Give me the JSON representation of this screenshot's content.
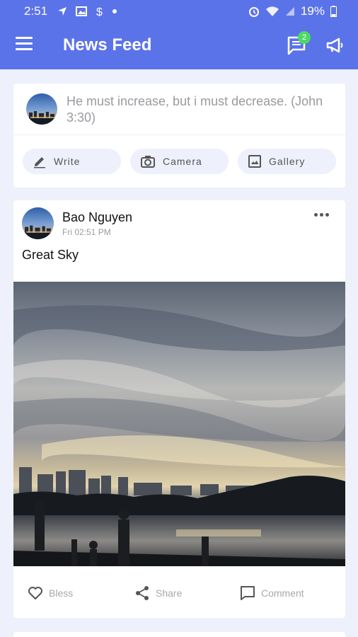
{
  "status_bar": {
    "time": "2:51",
    "battery": "19%"
  },
  "app_bar": {
    "title": "News Feed",
    "chat_badge": "2",
    "accent_color": "#5b73e8"
  },
  "composer": {
    "placeholder": "He must increase, but i must decrease. (John 3:30)",
    "actions": [
      {
        "label": "Write",
        "icon": "pencil-icon"
      },
      {
        "label": "Camera",
        "icon": "camera-icon"
      },
      {
        "label": "Gallery",
        "icon": "image-icon"
      }
    ]
  },
  "post": {
    "author": "Bao Nguyen",
    "timestamp": "Fri 02:51 PM",
    "caption": "Great Sky",
    "reactions": [
      {
        "label": "Bless",
        "icon": "heart-icon"
      },
      {
        "label": "Share",
        "icon": "share-icon"
      },
      {
        "label": "Comment",
        "icon": "comment-icon"
      }
    ]
  }
}
